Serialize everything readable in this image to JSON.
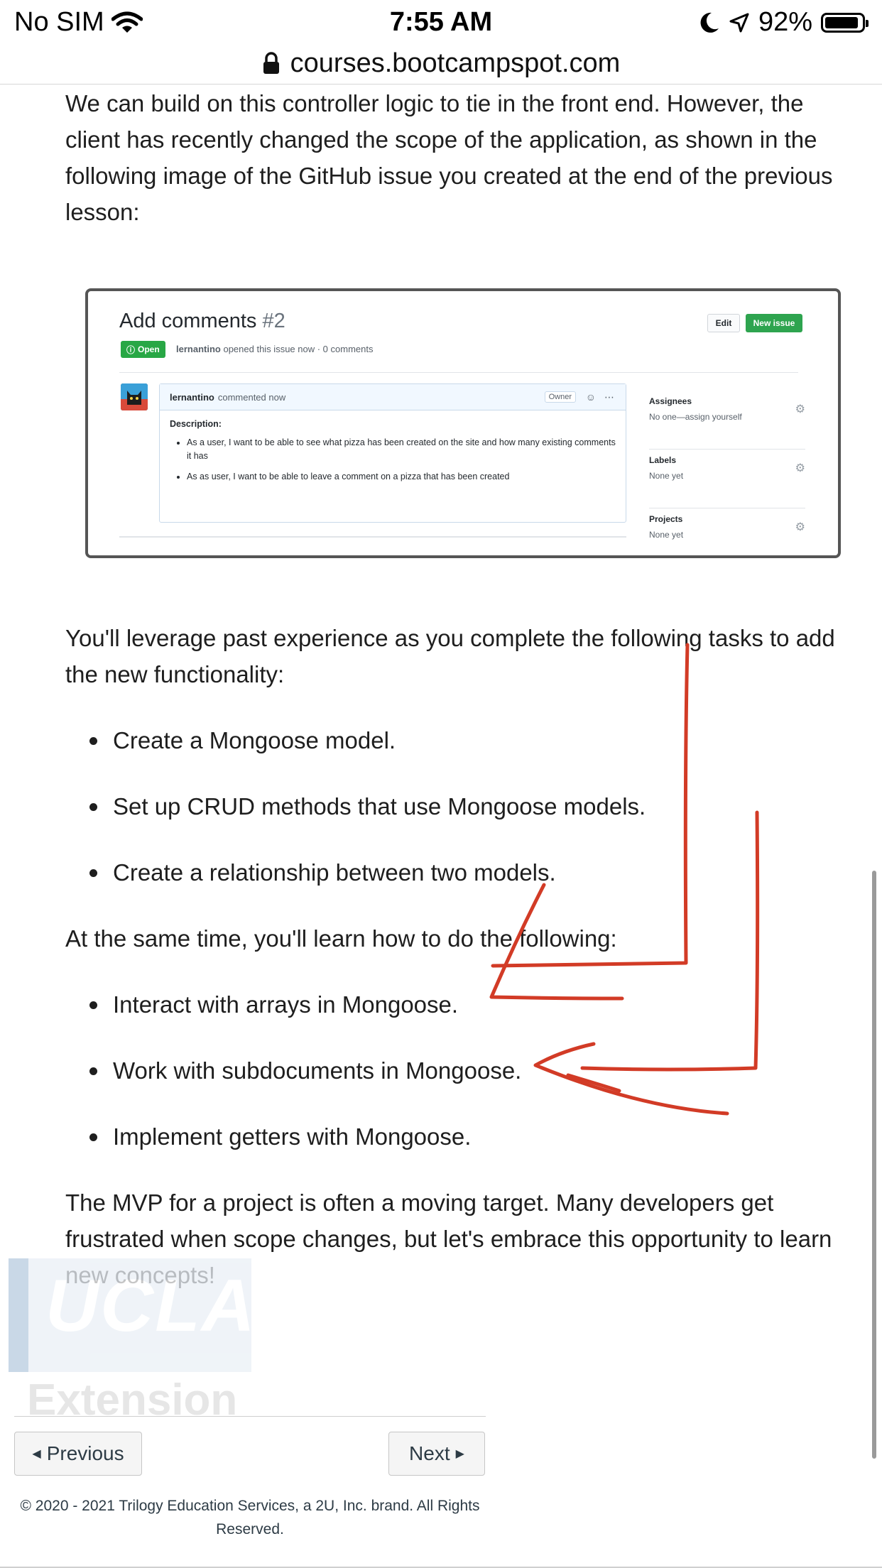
{
  "status_bar": {
    "carrier": "No SIM",
    "time": "7:55 AM",
    "battery": "92%",
    "battery_level": 0.92,
    "icons": [
      "wifi-icon",
      "moon-icon",
      "location-arrow-icon",
      "battery-icon"
    ]
  },
  "browser": {
    "url": "courses.bootcampspot.com",
    "icon": "lock-icon"
  },
  "content": {
    "intro": "We can build on this controller logic to tie in the front end. However, the client has recently changed the scope of the application, as shown in the following image of the GitHub issue you created at the end of the previous lesson:",
    "tasks_intro": "You'll leverage past experience as you complete the following tasks to add the new functionality:",
    "tasks": [
      "Create a Mongoose model.",
      "Set up CRUD methods that use Mongoose models.",
      "Create a relationship between two models."
    ],
    "learn_intro": "At the same time, you'll learn how to do the following:",
    "learn": [
      "Interact with arrays in Mongoose.",
      "Work with subdocuments in Mongoose.",
      "Implement getters with Mongoose."
    ],
    "closing": "The MVP for a project is often a moving target. Many developers get frustrated when scope changes, but let's embrace this opportunity to learn new concepts!"
  },
  "issue_image": {
    "title": "Add comments",
    "number": "#2",
    "edit_label": "Edit",
    "new_issue_label": "New issue",
    "status": "Open",
    "author": "lernantino",
    "meta": "opened this issue now · 0 comments",
    "comment_author": "lernantino",
    "comment_time": "commented now",
    "owner_badge": "Owner",
    "description_label": "Description:",
    "bullets": [
      "As a user, I want to be able to see what pizza has been created on the site and how many existing comments it has",
      "As as user, I want to be able to leave a comment on a pizza that has been created"
    ],
    "sidebar": [
      {
        "label": "Assignees",
        "value": "No one—assign yourself"
      },
      {
        "label": "Labels",
        "value": "None yet"
      },
      {
        "label": "Projects",
        "value": "None yet"
      }
    ],
    "colors": {
      "open": "#28a745",
      "new_issue": "#2ea44f"
    }
  },
  "watermark": {
    "line1": "UCLA",
    "line2": "Extension"
  },
  "nav": {
    "previous": "Previous",
    "next": "Next"
  },
  "footer": "© 2020 - 2021 Trilogy Education Services, a 2U, Inc. brand. All Rights Reserved.",
  "annotation_color": "#d23b26"
}
